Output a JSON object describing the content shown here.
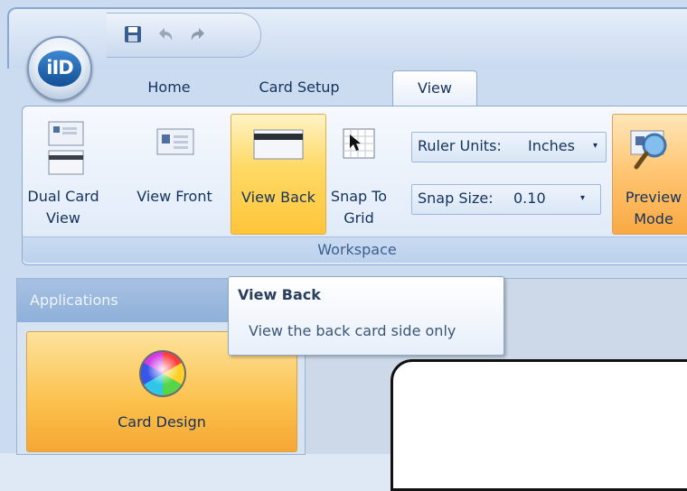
{
  "tabs": [
    {
      "label": "Home"
    },
    {
      "label": "Card Setup"
    },
    {
      "label": "View"
    }
  ],
  "ribbon": {
    "buttons": {
      "dual_card_view": "Dual Card\nView",
      "view_front": "View Front",
      "view_back": "View Back",
      "snap_to_grid": "Snap To\nGrid",
      "preview_mode": "Preview\nMode"
    },
    "ruler_units": {
      "label": "Ruler Units:",
      "value": "Inches"
    },
    "snap_size": {
      "label": "Snap Size:",
      "value": "0.10"
    },
    "group_label": "Workspace"
  },
  "tooltip": {
    "title": "View Back",
    "description": "View the back card side only"
  },
  "panel": {
    "title": "Applications",
    "card_design_label": "Card Design"
  },
  "colors": {
    "accent_orange": "#ffc53a",
    "ribbon_blue": "#dce8f7",
    "text_blue": "#15325e"
  }
}
